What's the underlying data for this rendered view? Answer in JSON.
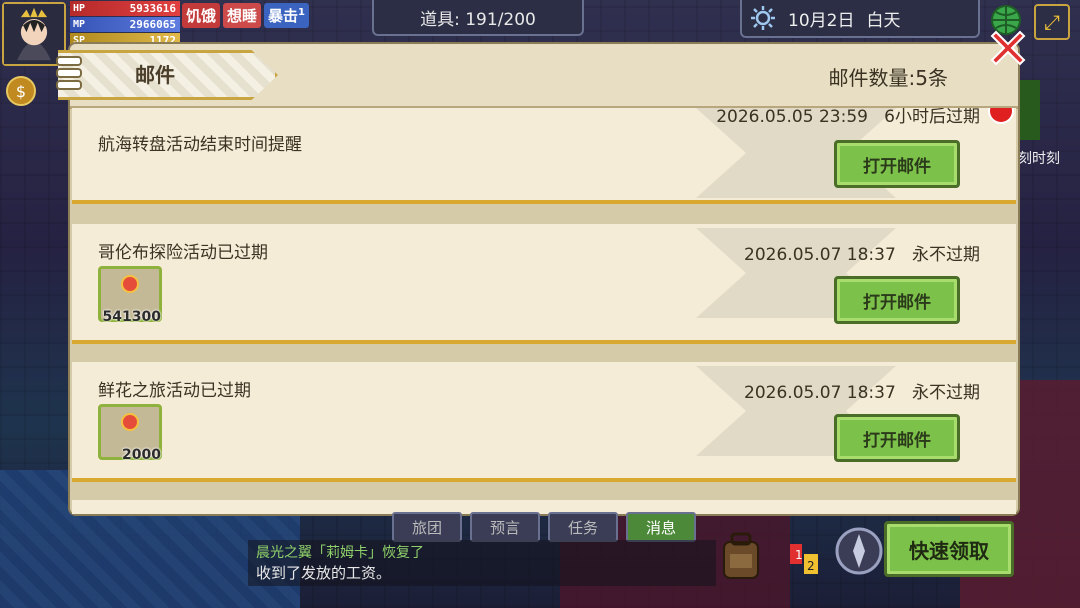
{
  "hud": {
    "stats": [
      {
        "label": "HP",
        "value": "5933616"
      },
      {
        "label": "MP",
        "value": "2966065"
      },
      {
        "label": "SP",
        "value": "1172"
      }
    ],
    "status_hunger": "饥饿",
    "status_sleepy": "想睡",
    "status_crit": "暴击",
    "status_crit_count": "1",
    "items_label": "道具: 191/200",
    "date": "10月2日",
    "time_of_day": "白天",
    "side_text": "刻时刻"
  },
  "mail_panel": {
    "title": "邮件",
    "count_label": "邮件数量:5条",
    "mails": [
      {
        "title": "航海转盘活动结束时间提醒",
        "datetime": "2026.05.05 23:59",
        "expiry": "6小时后过期",
        "open_label": "打开邮件",
        "has_reward": false,
        "unread_alert": true
      },
      {
        "title": "哥伦布探险活动已过期",
        "datetime": "2026.05.07 18:37",
        "expiry": "永不过期",
        "open_label": "打开邮件",
        "has_reward": true,
        "reward_qty": "541300"
      },
      {
        "title": "鲜花之旅活动已过期",
        "datetime": "2026.05.07 18:37",
        "expiry": "永不过期",
        "open_label": "打开邮件",
        "has_reward": true,
        "reward_qty": "2000"
      }
    ]
  },
  "bottom": {
    "tabs": [
      "旅团",
      "预言",
      "任务",
      "消息"
    ],
    "active_tab": "消息",
    "log_line1": "晨光之翼「莉姆卡」恢复了",
    "log_line2": "收到了发放的工资。",
    "quick_collect_label": "快速领取"
  },
  "colors": {
    "accent_green": "#7cc24a",
    "mail_border": "#d8a830",
    "hp": "#e14040",
    "mp": "#5f7ce0"
  },
  "icons": [
    "avatar",
    "sun-icon",
    "globe-icon",
    "expand-icon",
    "close-icon",
    "gem-icon",
    "bag-icon",
    "rank-icon",
    "compass-icon"
  ]
}
